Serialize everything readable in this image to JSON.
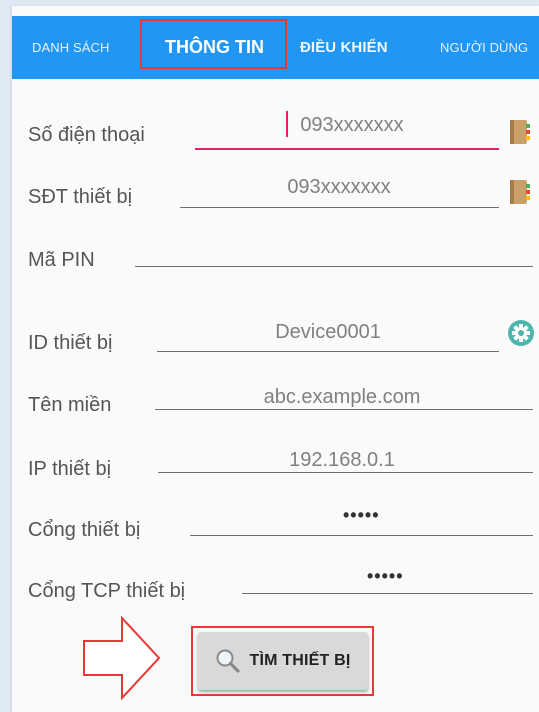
{
  "tabs": [
    {
      "label": "DANH SÁCH",
      "active": false
    },
    {
      "label": "THÔNG TIN",
      "active": true
    },
    {
      "label": "ĐIỀU KHIỂN",
      "active": false
    },
    {
      "label": "NGƯỜI DÙNG",
      "active": false
    }
  ],
  "form": {
    "phone": {
      "label": "Số điện thoại",
      "value": "093xxxxxxx",
      "icon": "contacts-book-icon"
    },
    "device_phone": {
      "label": "SĐT thiết bị",
      "value": "093xxxxxxx",
      "icon": "contacts-book-icon"
    },
    "pin": {
      "label": "Mã PIN",
      "value": ""
    },
    "device_id": {
      "label": "ID thiết bị",
      "value": "Device0001",
      "icon": "gear-icon"
    },
    "domain": {
      "label": "Tên miền",
      "value": "abc.example.com"
    },
    "device_ip": {
      "label": "IP thiết bị",
      "value": "192.168.0.1"
    },
    "device_port": {
      "label": "Cổng thiết bị",
      "value": "•••••"
    },
    "tcp_port": {
      "label": "Cổng TCP thiết bị",
      "value": "•••••"
    }
  },
  "find_button": {
    "label": "TÌM THIẾT BỊ",
    "icon": "magnifier-icon"
  },
  "colors": {
    "accent": "#2196f3",
    "focus": "#e91e63",
    "highlight": "#e53935",
    "gear": "#4db6ac"
  }
}
